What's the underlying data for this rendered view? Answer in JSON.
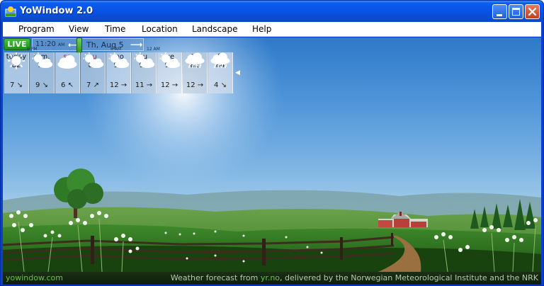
{
  "window": {
    "title": "YoWindow 2.0"
  },
  "menu": {
    "items": [
      "Program",
      "View",
      "Time",
      "Location",
      "Landscape",
      "Help"
    ]
  },
  "timebar": {
    "live_label": "LIVE",
    "time": "11:20",
    "time_ampm": "AM",
    "date": "Th, Aug 5",
    "tick_left": "6 PM",
    "tick_mid": "6 AM",
    "tick_right": "12 AM"
  },
  "forecast": {
    "days": [
      {
        "name": "today",
        "temp": "82",
        "icon": "sun-icon",
        "wind": "7",
        "dir": "↘",
        "weekend": false
      },
      {
        "name": "tom.",
        "temp": "76",
        "icon": "sun-cloud-icon",
        "wind": "9",
        "dir": "↘",
        "weekend": false
      },
      {
        "name": "sa",
        "temp": "72",
        "icon": "cloud-icon",
        "wind": "6",
        "dir": "↖",
        "weekend": true
      },
      {
        "name": "su",
        "temp": "80",
        "icon": "sun-cloud-icon",
        "wind": "7",
        "dir": "↗",
        "weekend": true
      },
      {
        "name": "mo",
        "temp": "90",
        "icon": "sun-cloud-icon",
        "wind": "12",
        "dir": "→",
        "weekend": false
      },
      {
        "name": "tu",
        "temp": "93",
        "icon": "sun-cloud-icon",
        "wind": "11",
        "dir": "→",
        "weekend": false
      },
      {
        "name": "we",
        "temp": "93",
        "icon": "sun-cloud-icon",
        "wind": "12",
        "dir": "→",
        "weekend": false
      },
      {
        "name": "th",
        "temp": "82",
        "icon": "cloud-rain-icon",
        "wind": "12",
        "dir": "→",
        "weekend": false
      },
      {
        "name": "fr",
        "temp": "84",
        "icon": "cloud-rain-icon",
        "wind": "4",
        "dir": "↘",
        "weekend": false
      }
    ]
  },
  "footer": {
    "brand": "yowindow.com",
    "credit_prefix": "Weather forecast from ",
    "credit_link": "yr.no",
    "credit_suffix": ", delivered by the Norwegian Meteorological Institute and the NRK"
  }
}
